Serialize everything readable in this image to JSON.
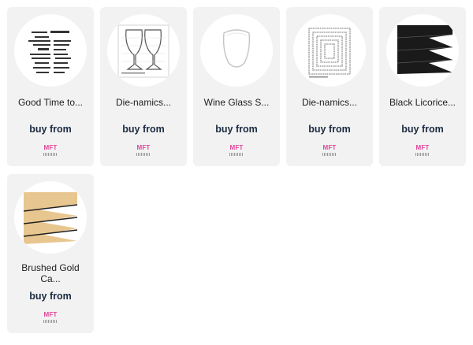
{
  "products": [
    {
      "title": "Good Time to...",
      "buy_label": "buy from",
      "brand_logo": "MFT",
      "image": "stamp-set-sentiments"
    },
    {
      "title": "Die-namics...",
      "buy_label": "buy from",
      "brand_logo": "MFT",
      "image": "wine-glass-die"
    },
    {
      "title": "Wine Glass S...",
      "buy_label": "buy from",
      "brand_logo": "MFT",
      "image": "wine-glass-shaker-window"
    },
    {
      "title": "Die-namics...",
      "buy_label": "buy from",
      "brand_logo": "MFT",
      "image": "nested-rectangle-dies"
    },
    {
      "title": "Black Licorice...",
      "buy_label": "buy from",
      "brand_logo": "MFT",
      "image": "black-cardstock"
    },
    {
      "title": "Brushed Gold Ca...",
      "buy_label": "buy from",
      "brand_logo": "MFT",
      "image": "gold-cardstock"
    }
  ],
  "colors": {
    "card_bg": "#f2f2f2",
    "buy_text": "#1a2a40",
    "brand_pink": "#e0479a"
  }
}
